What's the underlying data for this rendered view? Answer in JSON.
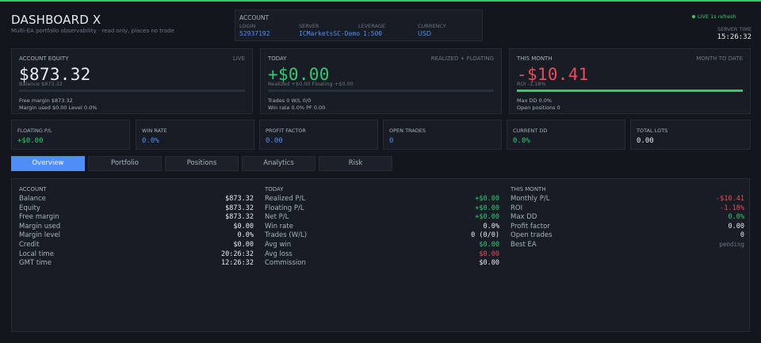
{
  "colors": {
    "accent": "#4f8ef7",
    "positive": "#2ecc71",
    "negative": "#ef4a5a",
    "background": "#13161d",
    "card": "#181c24"
  },
  "header": {
    "title": "DASHBOARD X",
    "subtitle": "Multi-EA portfolio observability · read only, places no trade",
    "live_label": "LIVE 1s refresh",
    "server_time_label": "SERVER TIME",
    "server_time": "15:26:32"
  },
  "account": {
    "heading": "ACCOUNT",
    "login_label": "LOGIN",
    "login": "52937192",
    "server_label": "SERVER",
    "server": "ICMarketsSC-Demo",
    "leverage_label": "LEVERAGE",
    "leverage": "1:500",
    "currency_label": "CURRENCY",
    "currency": "USD"
  },
  "cards": {
    "equity": {
      "label": "ACCOUNT EQUITY",
      "tag": "LIVE",
      "value": "$873.32",
      "sub": "Balance $873.32",
      "bar_fill": 0,
      "info1": "Free margin  $873.32",
      "info2": "Margin used  $0.00   Level  0.0%"
    },
    "today": {
      "label": "TODAY",
      "tag": "REALIZED + FLOATING",
      "value": "+$0.00",
      "sub": "Realized +$0.00   Floating +$0.00",
      "bar_fill": 0,
      "info1": "Trades  0   W/L  0/0",
      "info2": "Win rate  0.0%   PF  0.00"
    },
    "month": {
      "label": "THIS MONTH",
      "tag": "MONTH TO DATE",
      "value": "-$10.41",
      "sub": "ROI -1.18%",
      "bar_fill": 1,
      "info1": "Max DD  0.0%",
      "info2": "Open positions  0"
    }
  },
  "stats": [
    {
      "label": "FLOATING P/L",
      "value": "+$0.00",
      "tone": "green"
    },
    {
      "label": "WIN RATE",
      "value": "0.0%",
      "tone": "blue"
    },
    {
      "label": "PROFIT FACTOR",
      "value": "0.00",
      "tone": "blue"
    },
    {
      "label": "OPEN TRADES",
      "value": "0",
      "tone": "blue"
    },
    {
      "label": "CURRENT DD",
      "value": "0.0%",
      "tone": "green"
    },
    {
      "label": "TOTAL LOTS",
      "value": "0.00",
      "tone": "white"
    }
  ],
  "tabs": [
    "Overview",
    "Portfolio",
    "Positions",
    "Analytics",
    "Risk"
  ],
  "overview": {
    "account": {
      "heading": "ACCOUNT",
      "rows": [
        {
          "k": "Balance",
          "v": "$873.32"
        },
        {
          "k": "Equity",
          "v": "$873.32"
        },
        {
          "k": "Free margin",
          "v": "$873.32"
        },
        {
          "k": "Margin used",
          "v": "$0.00"
        },
        {
          "k": "Margin level",
          "v": "0.0%"
        },
        {
          "k": "Credit",
          "v": "$0.00"
        },
        {
          "k": "Local time",
          "v": "20:26:32"
        },
        {
          "k": "GMT time",
          "v": "12:26:32"
        }
      ]
    },
    "today": {
      "heading": "TODAY",
      "rows": [
        {
          "k": "Realized P/L",
          "v": "+$0.00"
        },
        {
          "k": "Floating P/L",
          "v": "+$0.00"
        },
        {
          "k": "Net P/L",
          "v": "+$0.00"
        },
        {
          "k": "Win rate",
          "v": "0.0%"
        },
        {
          "k": "Trades (W/L)",
          "v": "0 (0/0)"
        },
        {
          "k": "Avg win",
          "v": "$0.00"
        },
        {
          "k": "Avg loss",
          "v": "$0.00"
        },
        {
          "k": "Commission",
          "v": "$0.00"
        }
      ]
    },
    "month": {
      "heading": "THIS MONTH",
      "rows": [
        {
          "k": "Monthly P/L",
          "v": "-$10.41"
        },
        {
          "k": "ROI",
          "v": "-1.18%"
        },
        {
          "k": "Max DD",
          "v": "0.0%"
        },
        {
          "k": "Profit factor",
          "v": "0.00"
        },
        {
          "k": "Open trades",
          "v": "0"
        },
        {
          "k": "Best EA",
          "v": "pending"
        }
      ]
    }
  }
}
